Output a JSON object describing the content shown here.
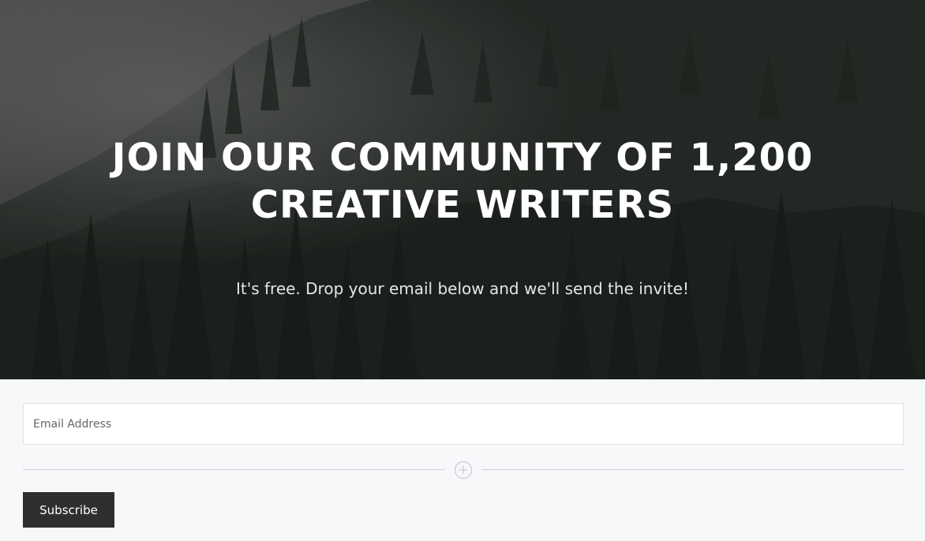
{
  "hero": {
    "title_line1": "JOIN OUR COMMUNITY OF 1,200",
    "title_line2": "CREATIVE WRITERS",
    "subtitle": "It's free. Drop your email below and we'll send the invite!"
  },
  "form": {
    "email_placeholder": "Email Address",
    "email_value": "",
    "subscribe_label": "Subscribe"
  },
  "icons": {
    "divider": "plus-circle-icon"
  },
  "colors": {
    "hero_overlay": "#2c302c",
    "button_bg": "#2f2f2f",
    "page_bg": "#f7f8fa",
    "divider": "#cfd2d6"
  }
}
